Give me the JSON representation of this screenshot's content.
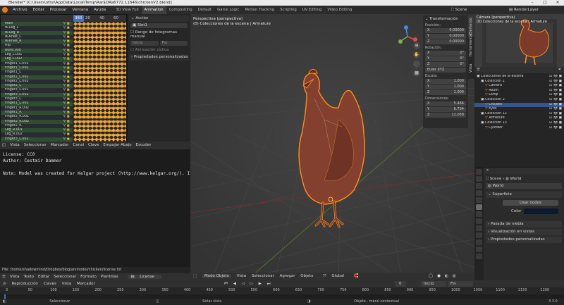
{
  "window": {
    "title": "Blender* [C:\\Users\\ottsi\\AppData\\Local\\Temp\\Rar$DRa6772.11646\\chickenV2.blend]"
  },
  "menus": [
    "Archivo",
    "Editar",
    "Procesar",
    "Ventana",
    "Ayuda"
  ],
  "workspaces": [
    "3D View Full",
    "Animation",
    "Compositing",
    "Default",
    "Game Logic",
    "Motion Tracking",
    "Scripting",
    "UV Editing",
    "Video Editing"
  ],
  "active_workspace": "Animation",
  "scene": {
    "label": "Scene",
    "render_layer": "RenderLayer"
  },
  "dopesheet": {
    "frame_numbers": [
      "20",
      "40",
      "60"
    ],
    "current_frame": "360",
    "channels": [
      "Main",
      "IK-Leg_L",
      "IK-Leg_R",
      "IK-Knee_L",
      "IK-Knee_R",
      "Hip",
      "Bone.008",
      "Leg_L.001",
      "Leg_L.002",
      "Finger1_L.001",
      "Finger1_L.002",
      "Finger1_L",
      "Finger2_L.001",
      "Finger2_L.002",
      "Finger2_L",
      "Finger3_L.001",
      "Finger3_L.002",
      "Finger3_L",
      "Finger1_L.001",
      "Finger1_R.002",
      "Finger1_R",
      "Finger2_R.001",
      "Finger2_R.002",
      "Finger2_R",
      "Leg_R.001",
      "Leg_R.002",
      "Finger3_L.002"
    ],
    "footer": [
      "Vista",
      "Seleccionar",
      "Marcador",
      "Canal",
      "Clave",
      "Empujar Abajo",
      "Escoder"
    ]
  },
  "action_panel": {
    "title": "Acción",
    "slot": "Slot1",
    "manual_range": "Rango de fotogramas manual",
    "start": "Inicio",
    "end": "Fin",
    "manual_frame": "Animación cíclica",
    "custom_props": "Propiedades personalizadas"
  },
  "text_editor": {
    "lines": [
      "License: CC0",
      "Author: Čestmír Dammer",
      "",
      "Note: Model was created for Kelgar project (http://www.kelgar.org/). I"
    ],
    "path": "File: /home/shadowmind/Dropbox/blog/animodel/chicken/license.txt",
    "header": [
      "Vista",
      "Texto",
      "Editar",
      "Seleccionar",
      "Formato",
      "Plantillas"
    ],
    "file": "License"
  },
  "viewport": {
    "info_line1": "Perspectiva (perspectiva)",
    "info_line2": "(0) Colecciones de la escena | Armature",
    "header": [
      "Modo Objeto",
      "Vista",
      "Seleccionar",
      "Agregar",
      "Objeto"
    ],
    "transform_orientation": "Global"
  },
  "npanel": {
    "title": "Transformación",
    "location_label": "Posición:",
    "location": [
      {
        "axis": "X",
        "value": "0.00000"
      },
      {
        "axis": "Y",
        "value": "0.00000"
      },
      {
        "axis": "Z",
        "value": "0.00000"
      }
    ],
    "rotation_label": "Rotación:",
    "rotation": [
      {
        "axis": "X",
        "value": "0°"
      },
      {
        "axis": "Y",
        "value": "0°"
      },
      {
        "axis": "Z",
        "value": "0°"
      }
    ],
    "rotation_mode": "Euler XYZ",
    "scale_label": "Escala:",
    "scale": [
      {
        "axis": "X",
        "value": "1.000"
      },
      {
        "axis": "Y",
        "value": "1.000"
      },
      {
        "axis": "Z",
        "value": "1.000"
      }
    ],
    "dimensions_label": "Dimensiones:",
    "dimensions": [
      {
        "axis": "X",
        "value": "5.466"
      },
      {
        "axis": "Y",
        "value": "6.734"
      },
      {
        "axis": "Z",
        "value": "12.058"
      }
    ],
    "tabs": [
      "Elemento",
      "Herramienta",
      "Vista"
    ]
  },
  "camera_view": {
    "line1": "Cámara (perspectiva)",
    "line2": "(0) Colecciones de la escena | Armature"
  },
  "outliner": {
    "rows": [
      {
        "label": "Colecciones de la escena",
        "indent": 0,
        "sel": false
      },
      {
        "label": "Colección 1",
        "indent": 1,
        "sel": false
      },
      {
        "label": "Camera",
        "indent": 2,
        "sel": false
      },
      {
        "label": "Room",
        "indent": 2,
        "sel": false
      },
      {
        "label": "Lamp",
        "indent": 2,
        "sel": false
      },
      {
        "label": "Colección 2",
        "indent": 1,
        "sel": false
      },
      {
        "label": "Chicken",
        "indent": 2,
        "sel": true
      },
      {
        "label": "Eyes",
        "indent": 2,
        "sel": false
      },
      {
        "label": "Colección 12",
        "indent": 1,
        "sel": false
      },
      {
        "label": "Armature",
        "indent": 2,
        "sel": false
      },
      {
        "label": "Colección 13",
        "indent": 1,
        "sel": false
      },
      {
        "label": "Cylinder",
        "indent": 2,
        "sel": false
      }
    ]
  },
  "properties": {
    "scene": "Scene",
    "world": "World",
    "world_field": "World",
    "surface": "Superficie",
    "use_nodes": "Usar nodos",
    "color_label": "Color",
    "sections": [
      "Pasada de niebla",
      "Visualización en vistas",
      "Propiedades personalizadas"
    ]
  },
  "timeline": {
    "header": [
      "Reproducción",
      "Claves",
      "Vista",
      "Marcador"
    ],
    "current_frame": "0",
    "start_label": "Inicio",
    "start": "1",
    "end_label": "Fin",
    "end": "1200",
    "ruler": [
      "0",
      "50",
      "100",
      "150",
      "200",
      "250",
      "300",
      "350",
      "400",
      "450",
      "500",
      "550",
      "600",
      "650",
      "700",
      "750",
      "800",
      "850",
      "900",
      "950",
      "1000",
      "1050",
      "1100",
      "1150",
      "1200"
    ]
  },
  "status": {
    "select": "Seleccionar",
    "rotate": "Rotar vista",
    "context": "Objeto - menú contextual",
    "version": "3.3.0"
  },
  "colors": {
    "accent": "#e87d0d",
    "selection": "#ff8c1a",
    "chicken": "#8a3d2d",
    "key": "#f0a73a"
  }
}
